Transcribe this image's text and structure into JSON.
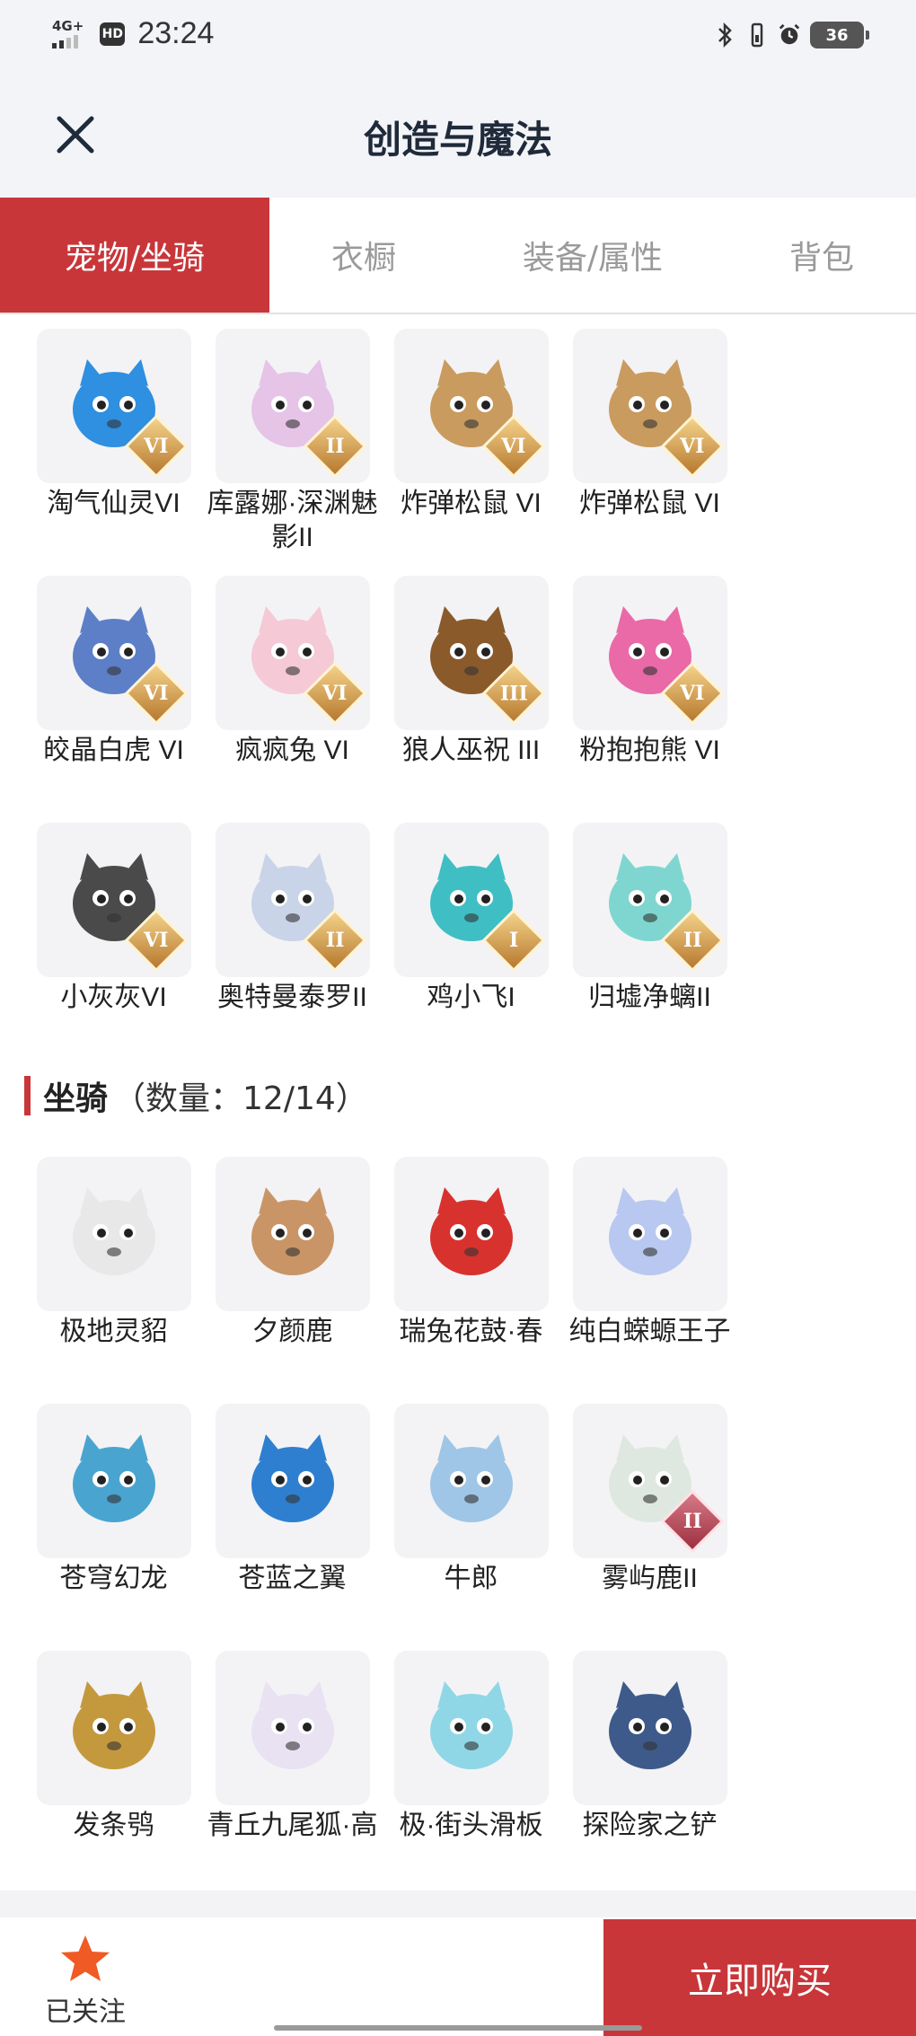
{
  "status_bar": {
    "network": "4G+",
    "hd": "HD",
    "time": "23:24",
    "battery": "36"
  },
  "nav": {
    "title": "创造与魔法"
  },
  "tabs": [
    {
      "label": "宠物/坐骑",
      "active": true
    },
    {
      "label": "衣橱",
      "active": false
    },
    {
      "label": "装备/属性",
      "active": false
    },
    {
      "label": "背包",
      "active": false
    }
  ],
  "pets": [
    {
      "label": "淘气仙灵VI",
      "rank": "VI",
      "color": "#2f8fe0",
      "icon": "blue-dog-pet-icon"
    },
    {
      "label": "库露娜·深渊魅影II",
      "rank": "II",
      "color": "#e5c4e8",
      "icon": "white-haired-girl-pet-icon"
    },
    {
      "label": "炸弹松鼠 VI",
      "rank": "VI",
      "color": "#c99b5e",
      "icon": "bomb-squirrel-pet-icon"
    },
    {
      "label": "炸弹松鼠 VI",
      "rank": "VI",
      "color": "#c99b5e",
      "icon": "bomb-squirrel-pet-icon"
    },
    {
      "label": "皎晶白虎 VI",
      "rank": "VI",
      "color": "#5d7fc7",
      "icon": "crystal-tiger-pet-icon"
    },
    {
      "label": "疯疯兔 VI",
      "rank": "VI",
      "color": "#f5c9d6",
      "icon": "crazy-rabbit-pet-icon"
    },
    {
      "label": "狼人巫祝 III",
      "rank": "III",
      "color": "#8a5a2b",
      "icon": "werewolf-shaman-pet-icon"
    },
    {
      "label": "粉抱抱熊 VI",
      "rank": "VI",
      "color": "#e96aa7",
      "icon": "pink-bear-pet-icon"
    },
    {
      "label": "小灰灰VI",
      "rank": "VI",
      "color": "#4a4a4a",
      "icon": "little-grey-dog-pet-icon"
    },
    {
      "label": "奥特曼泰罗II",
      "rank": "II",
      "color": "#c9d4e8",
      "icon": "ultraman-taro-pet-icon"
    },
    {
      "label": "鸡小飞I",
      "rank": "I",
      "color": "#3fbfc4",
      "icon": "chicken-muscle-pet-icon"
    },
    {
      "label": "归墟净螭II",
      "rank": "II",
      "color": "#7fd6d0",
      "icon": "jade-dragon-pet-icon"
    }
  ],
  "mount_section": {
    "title": "坐骑",
    "count": "（数量：12/14）"
  },
  "mounts": [
    {
      "label": "极地灵貂",
      "rank": "",
      "color": "#e8e8e8",
      "icon": "polar-ferret-mount-icon"
    },
    {
      "label": "夕颜鹿",
      "rank": "",
      "color": "#c99566",
      "icon": "sunset-deer-mount-icon"
    },
    {
      "label": "瑞兔花鼓·春",
      "rank": "",
      "color": "#d8322e",
      "icon": "rabbit-drum-mount-icon"
    },
    {
      "label": "纯白蝾螈王子",
      "rank": "",
      "color": "#b9c8f0",
      "icon": "white-axolotl-prince-mount-icon"
    },
    {
      "label": "苍穹幻龙",
      "rank": "",
      "color": "#4aa4d0",
      "icon": "sky-dragon-mount-icon"
    },
    {
      "label": "苍蓝之翼",
      "rank": "",
      "color": "#2f7fd0",
      "icon": "azure-wing-mount-icon"
    },
    {
      "label": "牛郎",
      "rank": "",
      "color": "#9fc6e6",
      "icon": "cowherd-ox-mount-icon"
    },
    {
      "label": "雾屿鹿II",
      "rank": "II",
      "color": "#dfe8e0",
      "icon": "mist-deer-mount-icon"
    },
    {
      "label": "发条鸮",
      "rank": "",
      "color": "#c4993e",
      "icon": "clockwork-owl-mount-icon"
    },
    {
      "label": "青丘九尾狐·高",
      "rank": "",
      "color": "#e8e2f2",
      "icon": "nine-tail-fox-mount-icon"
    },
    {
      "label": "极·街头滑板",
      "rank": "",
      "color": "#8fd7e6",
      "icon": "street-skateboard-mount-icon"
    },
    {
      "label": "探险家之铲",
      "rank": "",
      "color": "#3d5a8a",
      "icon": "explorer-shovel-mount-icon"
    }
  ],
  "bottom": {
    "follow_label": "已关注",
    "buy_label": "立即购买"
  },
  "colors": {
    "accent": "#c8363a",
    "star": "#f05a24"
  }
}
